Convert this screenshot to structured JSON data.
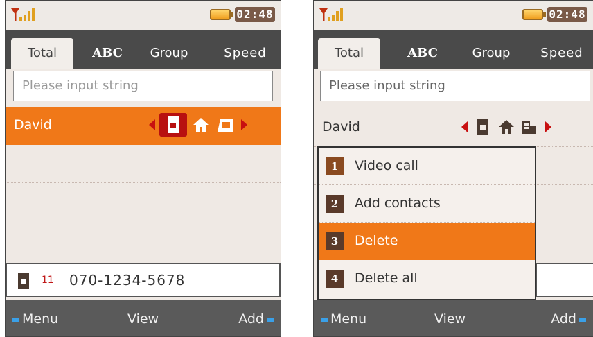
{
  "screen_left": {
    "status": {
      "time": "02:48"
    },
    "tabs": [
      {
        "label": "Total"
      },
      {
        "label": "ABC"
      },
      {
        "label": "Group"
      },
      {
        "label": "Speed"
      }
    ],
    "search": {
      "placeholder": "Please input string"
    },
    "contact": {
      "name": "David"
    },
    "bottom": {
      "count": "11",
      "number": "070-1234-5678"
    },
    "softkeys": {
      "left": "Menu",
      "center": "View",
      "right": "Add"
    }
  },
  "screen_right": {
    "status": {
      "time": "02:48"
    },
    "tabs": [
      {
        "label": "Total"
      },
      {
        "label": "ABC"
      },
      {
        "label": "Group"
      },
      {
        "label": "Speed"
      }
    ],
    "search": {
      "placeholder": "Please input string"
    },
    "contact": {
      "name": "David"
    },
    "menu": [
      {
        "num": "1",
        "label": "Video call"
      },
      {
        "num": "2",
        "label": "Add contacts"
      },
      {
        "num": "3",
        "label": "Delete"
      },
      {
        "num": "4",
        "label": "Delete all"
      }
    ],
    "softkeys": {
      "left": "Menu",
      "center": "View",
      "right": "Add"
    }
  },
  "colors": {
    "accent": "#f07818",
    "tabbar": "#4a4a4a",
    "softkeys": "#5a5a5a",
    "badge": "#5a3a2a"
  },
  "icons": [
    "signal-icon",
    "battery-icon",
    "mobile-phone-icon",
    "home-icon",
    "office-icon",
    "left-arrow-icon",
    "right-arrow-icon"
  ]
}
